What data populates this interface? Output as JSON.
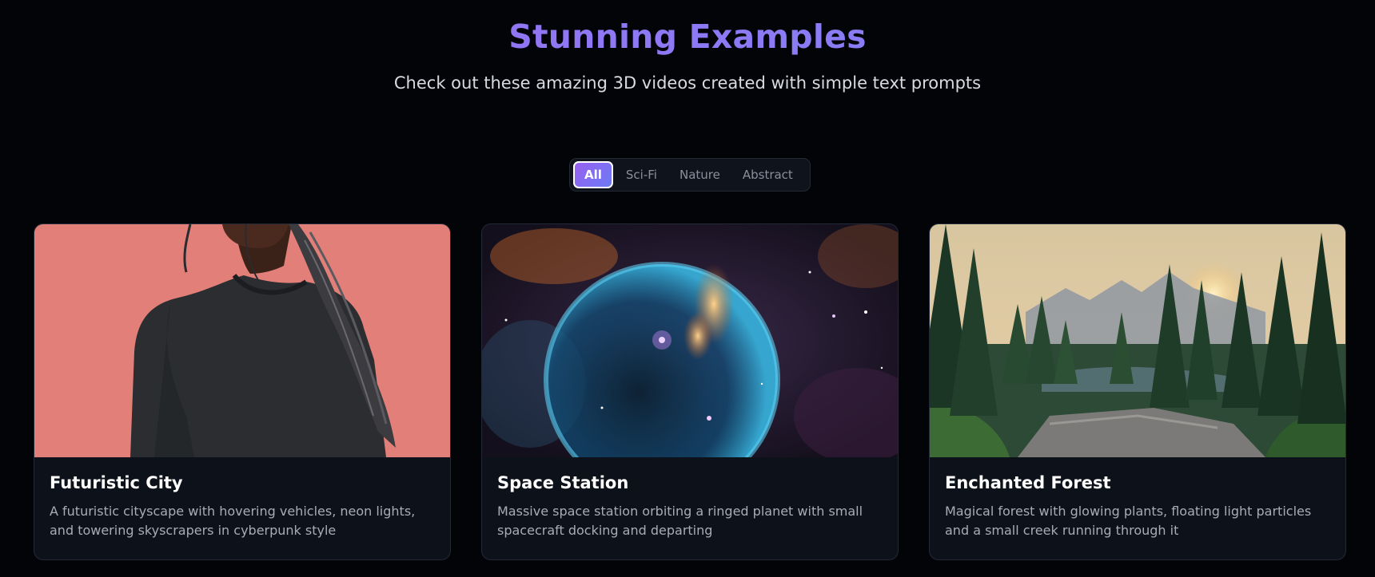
{
  "hero": {
    "title": "Stunning Examples",
    "subtitle": "Check out these amazing 3D videos created with simple text prompts"
  },
  "filters": [
    {
      "label": "All",
      "active": true
    },
    {
      "label": "Sci-Fi",
      "active": false
    },
    {
      "label": "Nature",
      "active": false
    },
    {
      "label": "Abstract",
      "active": false
    }
  ],
  "cards": [
    {
      "title": "Futuristic City",
      "description": "A futuristic cityscape with hovering vehicles, neon lights, and towering skyscrapers in cyberpunk style"
    },
    {
      "title": "Space Station",
      "description": "Massive space station orbiting a ringed planet with small spacecraft docking and departing"
    },
    {
      "title": "Enchanted Forest",
      "description": "Magical forest with glowing plants, floating light particles and a small creek running through it"
    }
  ],
  "colors": {
    "background": "#030407",
    "accent_from": "#9a5ff0",
    "accent_to": "#6a7cf4",
    "card_bg": "#0d111a"
  }
}
